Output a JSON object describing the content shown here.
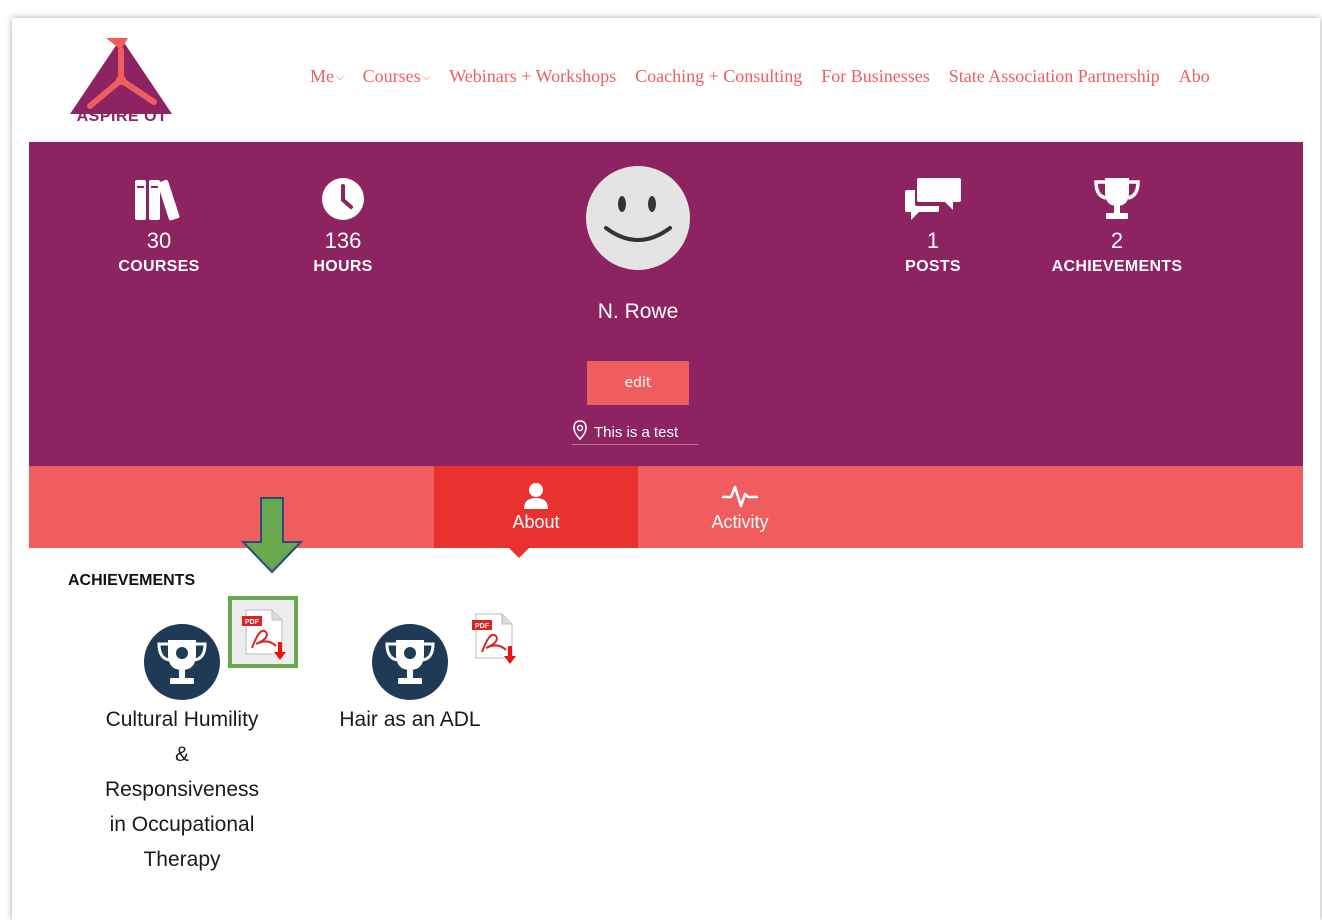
{
  "header": {
    "logo_text": "ASPIRE OT",
    "nav": [
      {
        "label": "Me",
        "caret": true
      },
      {
        "label": "Courses",
        "caret": true
      },
      {
        "label": "Webinars + Workshops",
        "caret": false
      },
      {
        "label": "Coaching + Consulting",
        "caret": false
      },
      {
        "label": "For Businesses",
        "caret": false
      },
      {
        "label": "State Association Partnership",
        "caret": false
      },
      {
        "label": "Abo",
        "caret": false
      }
    ]
  },
  "profile": {
    "stats": [
      {
        "icon": "books-icon",
        "value": "30",
        "label": "COURSES"
      },
      {
        "icon": "clock-icon",
        "value": "136",
        "label": "HOURS"
      },
      {
        "icon": "chat-bubbles-icon",
        "value": "1",
        "label": "POSTS"
      },
      {
        "icon": "trophy-icon",
        "value": "2",
        "label": "ACHIEVEMENTS"
      }
    ],
    "name": "N. Rowe",
    "edit_label": "edit",
    "location": "This is a test"
  },
  "tabs": [
    {
      "label": "About",
      "icon": "user-icon",
      "active": true
    },
    {
      "label": "Activity",
      "icon": "activity-pulse-icon",
      "active": false
    }
  ],
  "achievements": {
    "heading": "ACHIEVEMENTS",
    "items": [
      {
        "title_lines": [
          "Cultural Humility",
          "&",
          "Responsiveness",
          "in Occupational",
          "Therapy"
        ],
        "pdf_label": "PDF"
      },
      {
        "title_lines": [
          "Hair as an ADL"
        ],
        "pdf_label": "PDF"
      }
    ]
  },
  "colors": {
    "brand_purple": "#8e2361",
    "coral": "#f05d5e",
    "tab_active": "#e9322f",
    "badge_navy": "#1f3a55",
    "annotation_green": "#6aa84f"
  }
}
